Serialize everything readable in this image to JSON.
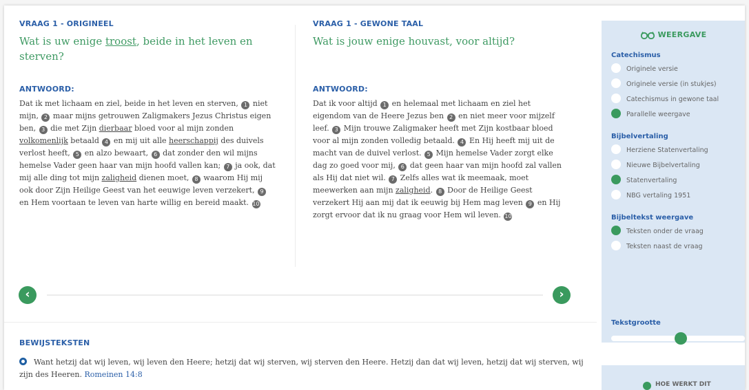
{
  "left": {
    "label": "VRAAG 1 - ORIGINEEL",
    "question_before": "Wat is uw enige ",
    "question_underlined": "troost",
    "question_after": ", beide in het leven en sterven?",
    "answer_label": "ANTWOORD:",
    "answer": [
      {
        "t": "Dat ik met lichaam en ziel, beide in het leven en sterven, "
      },
      {
        "fn": "1"
      },
      {
        "t": " niet mijn, "
      },
      {
        "fn": "2"
      },
      {
        "t": " maar mijns getrouwen Zaligmakers Jezus Christus eigen ben, "
      },
      {
        "fn": "3"
      },
      {
        "t": " die met Zijn "
      },
      {
        "u": "dierbaar"
      },
      {
        "t": " bloed voor al mijn zonden "
      },
      {
        "u": "volkomenlijk"
      },
      {
        "t": " betaald "
      },
      {
        "fn": "4"
      },
      {
        "t": " en mij uit alle "
      },
      {
        "u": "heerschappij"
      },
      {
        "t": " des duivels verlost heeft, "
      },
      {
        "fn": "5"
      },
      {
        "t": " en alzo bewaart, "
      },
      {
        "fn": "6"
      },
      {
        "t": " dat zonder den wil mijns hemelse Vader geen haar van mijn hoofd vallen kan; "
      },
      {
        "fn": "7"
      },
      {
        "t": " ja ook, dat mij alle ding tot mijn "
      },
      {
        "u": "zaligheid"
      },
      {
        "t": " dienen moet, "
      },
      {
        "fn": "8"
      },
      {
        "t": " waarom Hij mij ook door Zijn Heilige Geest van het eeuwige leven verzekert, "
      },
      {
        "fn": "9"
      },
      {
        "t": " en Hem voortaan te leven van harte willig en bereid maakt. "
      },
      {
        "fn": "10"
      }
    ]
  },
  "right": {
    "label": "VRAAG 1 - GEWONE TAAL",
    "question": "Wat is jouw enige houvast, voor altijd?",
    "answer_label": "ANTWOORD:",
    "answer": [
      {
        "t": "Dat ik voor altijd "
      },
      {
        "fn": "1"
      },
      {
        "t": " en helemaal met lichaam en ziel het eigendom van de Heere Jezus ben "
      },
      {
        "fn": "2"
      },
      {
        "t": " en niet meer voor mijzelf leef. "
      },
      {
        "fn": "3"
      },
      {
        "t": " Mijn trouwe Zaligmaker heeft met Zijn kostbaar bloed voor al mijn zonden volledig betaald. "
      },
      {
        "fn": "4"
      },
      {
        "t": " En Hij heeft mij uit de macht van de duivel verlost. "
      },
      {
        "fn": "5"
      },
      {
        "t": " Mijn hemelse Vader zorgt elke dag zo goed voor mij, "
      },
      {
        "fn": "6"
      },
      {
        "t": " dat geen haar van mijn hoofd zal vallen als Hij dat niet wil. "
      },
      {
        "fn": "7"
      },
      {
        "t": " Zelfs alles wat ik meemaak, moet meewerken aan mijn "
      },
      {
        "u": "zaligheid"
      },
      {
        "t": ". "
      },
      {
        "fn": "8"
      },
      {
        "t": " Door de Heilige Geest verzekert Hij aan mij dat ik eeuwig bij Hem mag leven "
      },
      {
        "fn": "9"
      },
      {
        "t": " en Hij zorgt ervoor dat ik nu graag voor Hem wil leven. "
      },
      {
        "fn": "10"
      }
    ]
  },
  "nav": {
    "prev": "‹",
    "next": "›"
  },
  "bewijsteksten": {
    "label": "BEWIJSTEKSTEN",
    "text": "Want hetzij dat wij leven, wij leven den Heere; hetzij dat wij sterven, wij sterven den Heere. Hetzij dan dat wij leven, hetzij dat wij sterven, wij zijn des Heeren.",
    "ref": "Romeinen 14:8"
  },
  "sidebar": {
    "header": "WEERGAVE",
    "sections": [
      {
        "title": "Catechismus",
        "options": [
          {
            "label": "Originele versie",
            "selected": false
          },
          {
            "label": "Originele versie (in stukjes)",
            "selected": false
          },
          {
            "label": "Catechismus in gewone taal",
            "selected": false
          },
          {
            "label": "Parallelle weergave",
            "selected": true
          }
        ]
      },
      {
        "title": "Bijbelvertaling",
        "options": [
          {
            "label": "Herziene Statenvertaling",
            "selected": false
          },
          {
            "label": "Nieuwe Bijbelvertaling",
            "selected": false
          },
          {
            "label": "Statenvertaling",
            "selected": true
          },
          {
            "label": "NBG vertaling 1951",
            "selected": false
          }
        ]
      },
      {
        "title": "Bijbeltekst weergave",
        "options": [
          {
            "label": "Teksten onder de vraag",
            "selected": true
          },
          {
            "label": "Teksten naast de vraag",
            "selected": false
          }
        ]
      }
    ],
    "font_size_label": "Tekstgrootte",
    "font_size_level": 0.52
  },
  "sidebar2": {
    "text": "HOE WERKT DIT"
  },
  "colors": {
    "green": "#3a9a5e",
    "blue": "#2b5fa8",
    "sidebar_bg": "#dbe7f4"
  }
}
